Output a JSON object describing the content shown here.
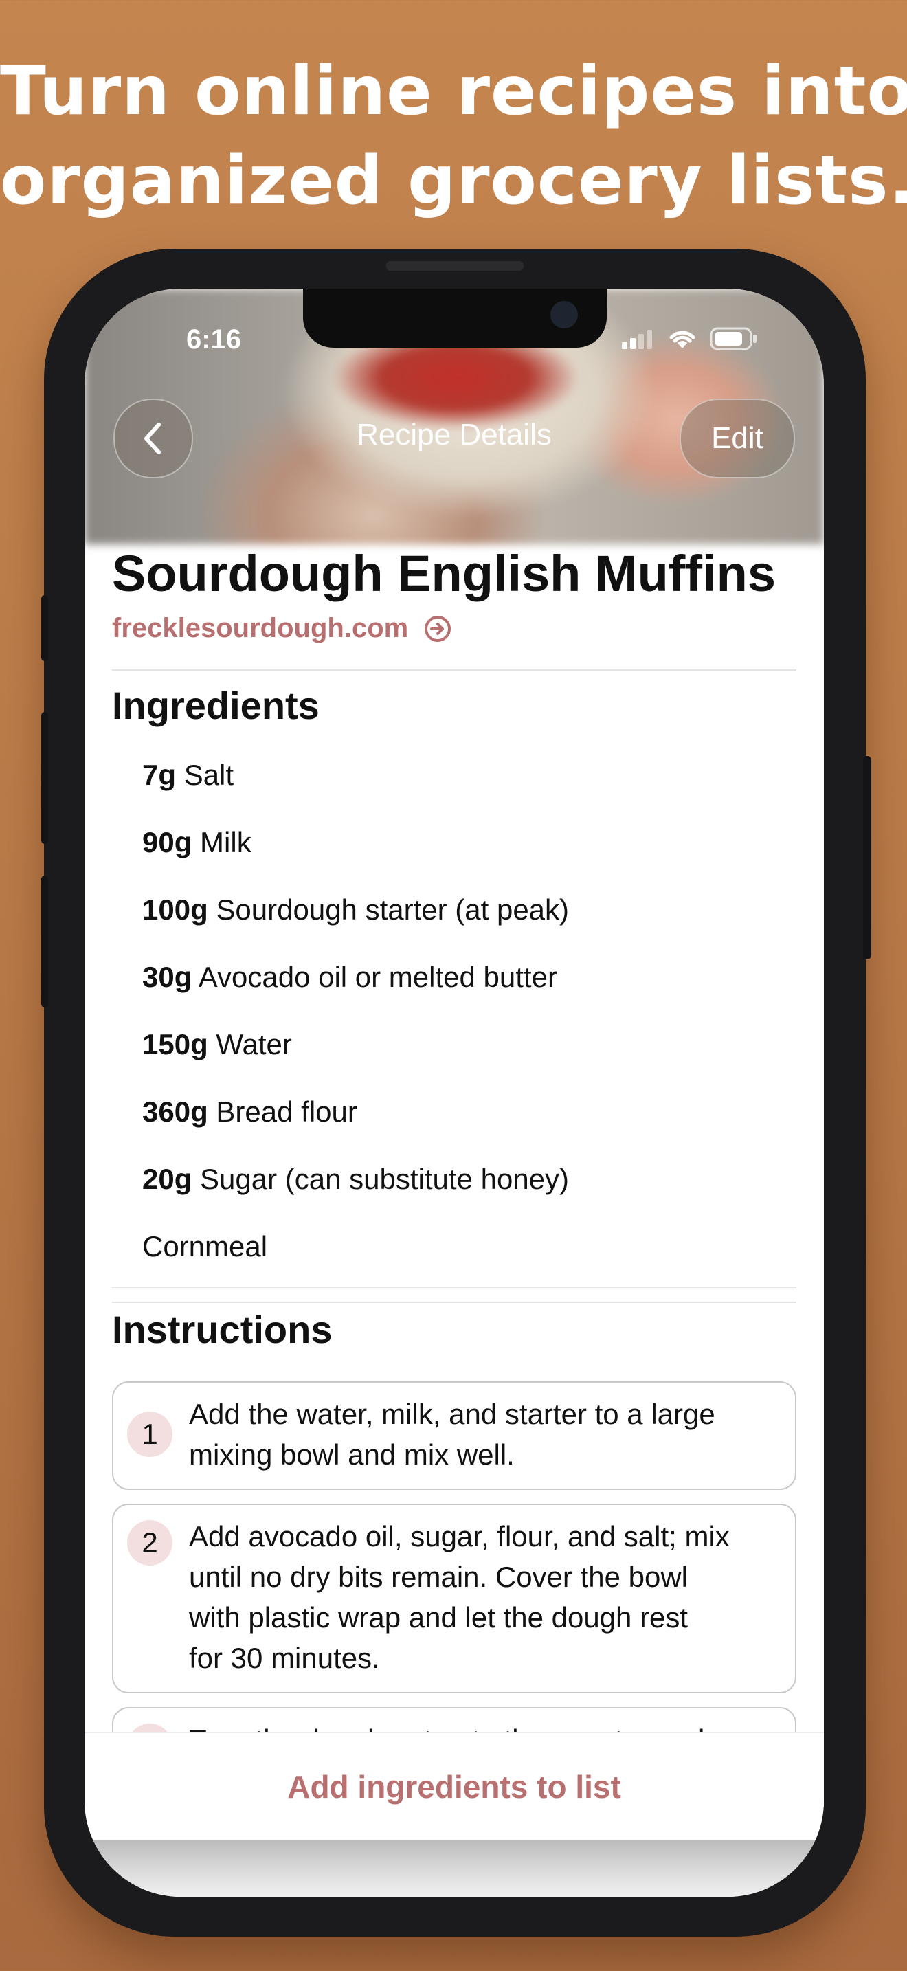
{
  "headline": {
    "line1": "Turn online recipes into",
    "line2": "organized grocery lists."
  },
  "status_bar": {
    "time": "6:16"
  },
  "nav": {
    "back_icon": "chevron-left-icon",
    "title": "Recipe Details",
    "edit_label": "Edit"
  },
  "recipe": {
    "title": "Sourdough English Muffins",
    "source": "frecklesourdough.com",
    "source_icon": "arrow-circle-right-icon"
  },
  "ingredients": {
    "heading": "Ingredients",
    "items": [
      {
        "qty": "7g",
        "name": "Salt"
      },
      {
        "qty": "90g",
        "name": "Milk"
      },
      {
        "qty": "100g",
        "name": "Sourdough starter (at peak)"
      },
      {
        "qty": "30g",
        "name": "Avocado oil or melted butter"
      },
      {
        "qty": "150g",
        "name": "Water"
      },
      {
        "qty": "360g",
        "name": "Bread flour"
      },
      {
        "qty": "20g",
        "name": "Sugar (can substitute honey)"
      },
      {
        "qty": "",
        "name": "Cornmeal"
      }
    ]
  },
  "instructions": {
    "heading": "Instructions",
    "steps": [
      {
        "num": "1",
        "lines": [
          "Add the water, milk, and starter to a large",
          "mixing bowl and mix well."
        ]
      },
      {
        "num": "2",
        "lines": [
          "Add avocado oil, sugar, flour, and salt; mix",
          "until no dry bits remain. Cover the bowl",
          "with plastic wrap and let the dough rest",
          "for 30 minutes."
        ]
      },
      {
        "num": "3",
        "lines": [
          "Turn the dough out onto the counter and"
        ]
      }
    ]
  },
  "bottom_action": {
    "label": "Add ingredients to list"
  },
  "colors": {
    "accent": "#b86f6f",
    "background": "#c4854f",
    "step_badge": "#f3dfdf"
  }
}
